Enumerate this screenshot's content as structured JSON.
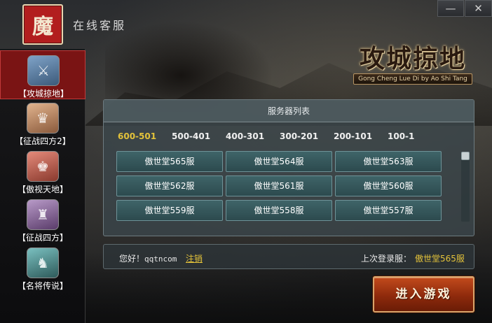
{
  "window": {
    "title": "在线客服"
  },
  "logo": {
    "glyph": "魔"
  },
  "window_controls": {
    "minimize": "—",
    "close": "✕"
  },
  "game_logo": {
    "title": "攻城掠地",
    "subtitle": "Gong Cheng Lue Di by Ao Shi Tang"
  },
  "sidebar": {
    "items": [
      {
        "label": "【攻城掠地】",
        "active": true,
        "color": "#5a7fa6"
      },
      {
        "label": "【征战四方2】",
        "active": false,
        "color": "#b8896a"
      },
      {
        "label": "【傲视天地】",
        "active": false,
        "color": "#c56a5a"
      },
      {
        "label": "【征战四方】",
        "active": false,
        "color": "#8a6a9a"
      },
      {
        "label": "【名将传说】",
        "active": false,
        "color": "#4f8a8a"
      }
    ]
  },
  "server_panel": {
    "header": "服务器列表",
    "ranges": [
      "600-501",
      "500-401",
      "400-301",
      "300-201",
      "200-101",
      "100-1"
    ],
    "active_range": 0,
    "servers": [
      "傲世堂565服",
      "傲世堂564服",
      "傲世堂563服",
      "傲世堂562服",
      "傲世堂561服",
      "傲世堂560服",
      "傲世堂559服",
      "傲世堂558服",
      "傲世堂557服"
    ]
  },
  "user_bar": {
    "greeting": "您好！",
    "username": "qqtncom",
    "logout": "注销",
    "last_login_label": "上次登录服：",
    "last_login_server": "傲世堂565服"
  },
  "enter_button": {
    "label": "进入游戏"
  },
  "colors": {
    "accent": "#e3c23a",
    "active_sidebar": "#7a1414"
  }
}
